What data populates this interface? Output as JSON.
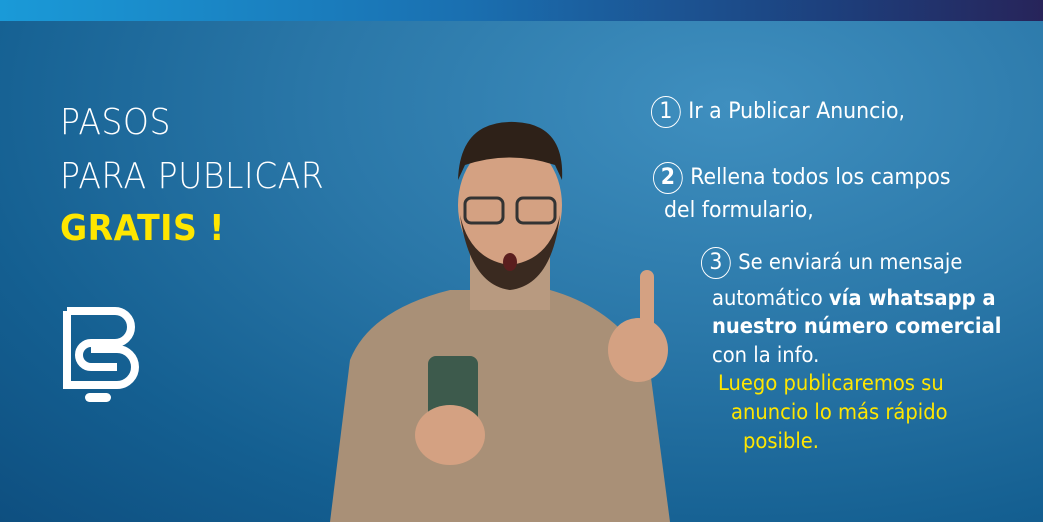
{
  "heading": {
    "line1": "PASOS",
    "line2": "PARA PUBLICAR",
    "line3": "GRATIS !"
  },
  "logo": {
    "letters": "BS"
  },
  "steps": [
    {
      "number": "1",
      "text": "Ir a Publicar Anuncio,"
    },
    {
      "number": "2",
      "text": "Rellena todos los campos",
      "text2": "del formulario,"
    },
    {
      "number": "3",
      "text": "Se enviará un mensaje",
      "text2a": "automático ",
      "text2b": "vía whatsapp a",
      "text3": "nuestro número comercial",
      "text4": "con la info."
    }
  ],
  "closing": {
    "line1": "Luego publicaremos su",
    "line2": "anuncio lo más rápido",
    "line3": "posible."
  },
  "colors": {
    "background": "#2a77a8",
    "accent": "#ffe600",
    "text": "#ffffff"
  }
}
